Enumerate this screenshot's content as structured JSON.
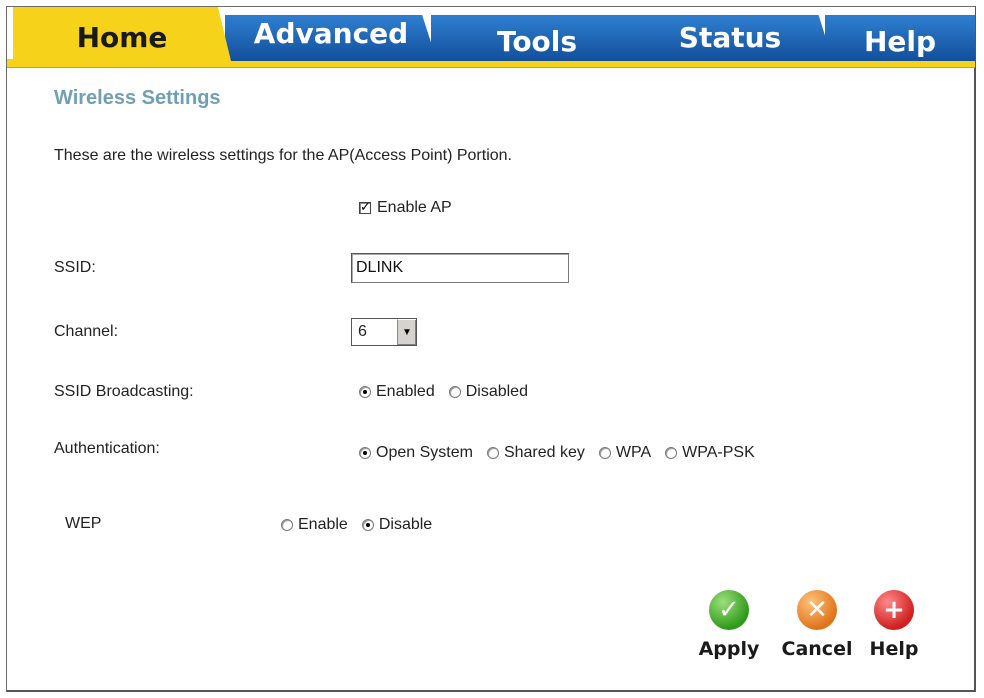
{
  "tabs": {
    "home": "Home",
    "advanced": "Advanced",
    "tools": "Tools",
    "status": "Status",
    "help": "Help",
    "active": "Home"
  },
  "page": {
    "title": "Wireless Settings",
    "description": "These are the wireless settings for the AP(Access Point) Portion."
  },
  "enable_ap": {
    "label": "Enable AP",
    "checked": true
  },
  "ssid": {
    "label": "SSID:",
    "value": "DLINK"
  },
  "channel": {
    "label": "Channel:",
    "value": "6"
  },
  "ssid_broadcasting": {
    "label": "SSID Broadcasting:",
    "options": [
      "Enabled",
      "Disabled"
    ],
    "selected": "Enabled"
  },
  "authentication": {
    "label": "Authentication:",
    "options": [
      "Open System",
      "Shared key",
      "WPA",
      "WPA-PSK"
    ],
    "selected": "Open System"
  },
  "wep": {
    "label": "WEP",
    "options": [
      "Enable",
      "Disable"
    ],
    "selected": "Disable"
  },
  "actions": {
    "apply": "Apply",
    "cancel": "Cancel",
    "help": "Help"
  },
  "icons": {
    "apply": "check-icon",
    "cancel": "x-icon",
    "help": "plus-icon"
  },
  "colors": {
    "tab_active": "#f6d21b",
    "tab_inactive": "#1f64b3",
    "title": "#6f9fb5",
    "apply": "#2f9a1a",
    "cancel": "#e0741a",
    "help": "#cf1f1f"
  }
}
